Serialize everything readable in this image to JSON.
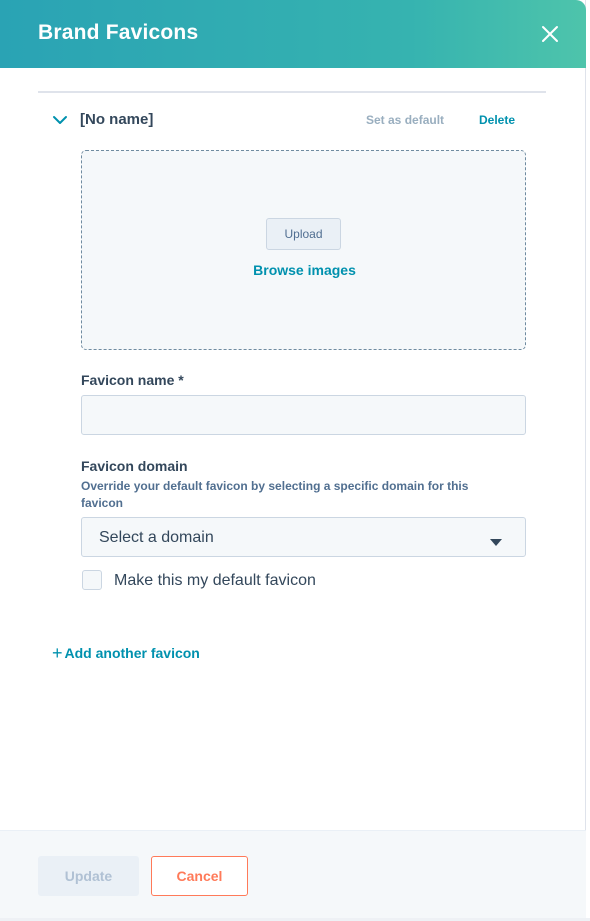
{
  "header": {
    "title": "Brand Favicons",
    "close_icon": "close-icon"
  },
  "favicon_item": {
    "title": "[No name]",
    "set_default_label": "Set as default",
    "delete_label": "Delete",
    "dropzone": {
      "upload_label": "Upload",
      "browse_label": "Browse images"
    },
    "name_field": {
      "label": "Favicon name *",
      "value": "",
      "placeholder": ""
    },
    "domain_field": {
      "label": "Favicon domain",
      "help": "Override your default favicon by selecting a specific domain for this favicon",
      "selected": "Select a domain"
    },
    "default_checkbox": {
      "label": "Make this my default favicon",
      "checked": false
    }
  },
  "add_another": {
    "symbol": "+",
    "label": "Add another favicon"
  },
  "footer": {
    "update_label": "Update",
    "cancel_label": "Cancel"
  },
  "colors": {
    "header_gradient_start": "#2aa3b4",
    "header_gradient_end": "#4ec4ab",
    "link": "#0091ae",
    "cancel_accent": "#ff7a59",
    "text": "#33475b"
  }
}
